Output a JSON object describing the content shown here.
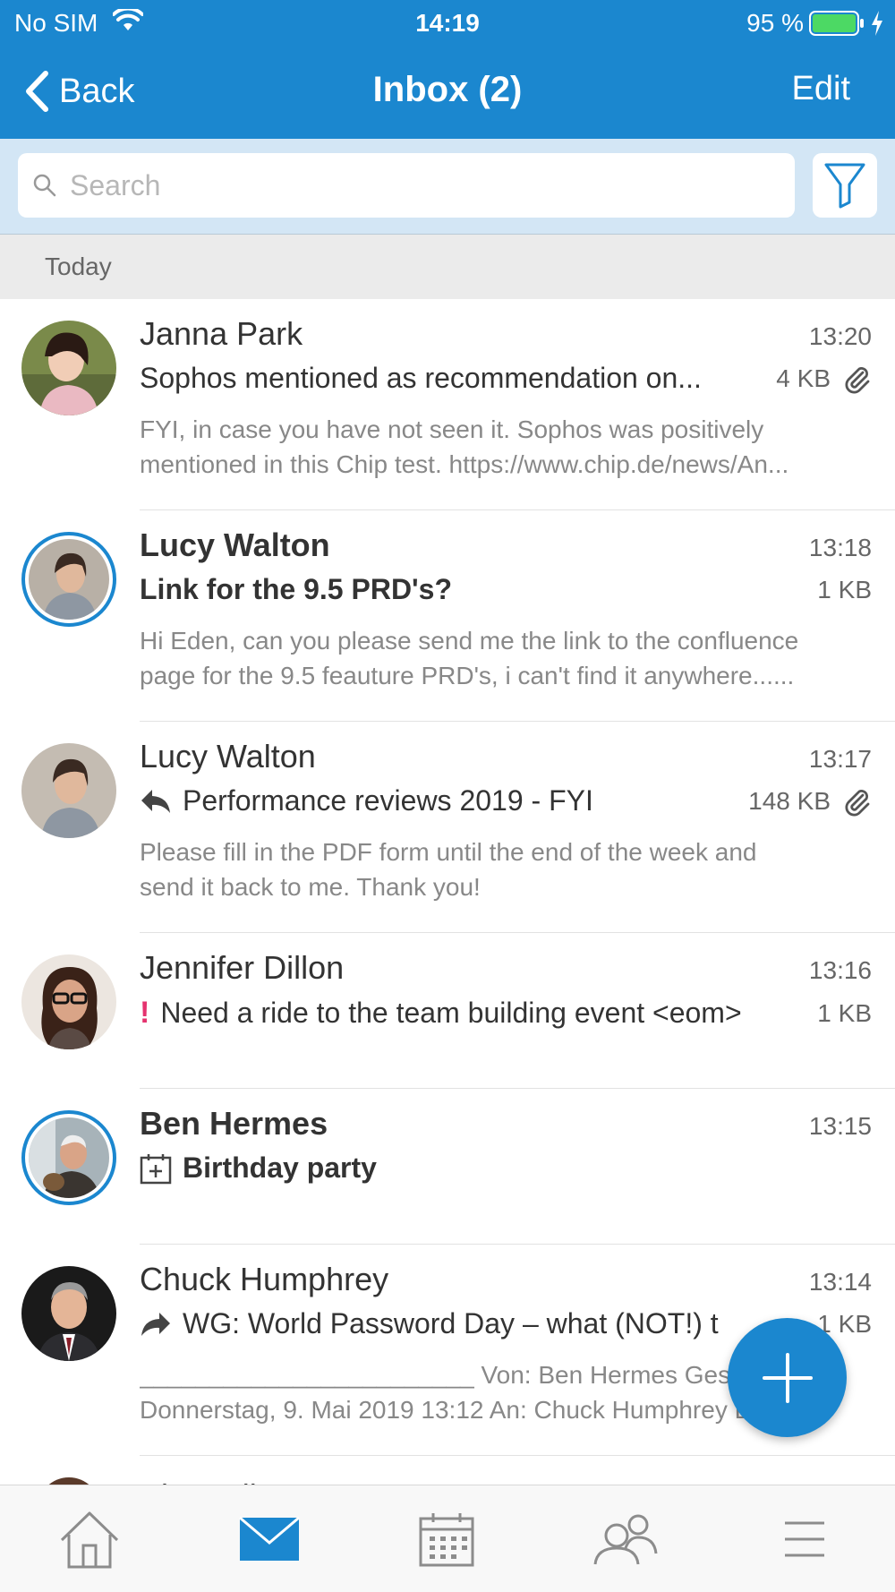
{
  "status_bar": {
    "carrier": "No SIM",
    "time": "14:19",
    "battery": "95 %"
  },
  "nav": {
    "back_label": "Back",
    "title": "Inbox (2)",
    "edit_label": "Edit"
  },
  "search": {
    "placeholder": "Search"
  },
  "section": {
    "label": "Today"
  },
  "colors": {
    "accent": "#1b87cf",
    "flag": "#e5336f"
  },
  "mails": [
    {
      "sender": "Janna Park",
      "time": "13:20",
      "subject": "Sophos mentioned as recommendation on...",
      "size": "4 KB",
      "attachment": true,
      "unread": false,
      "prefix_icon": "",
      "preview_line1": "FYI, in case you have not seen it. Sophos was positively",
      "preview_line2": "mentioned in this Chip test. https://www.chip.de/news/An..."
    },
    {
      "sender": "Lucy Walton",
      "time": "13:18",
      "subject": "Link for the 9.5 PRD's?",
      "size": "1 KB",
      "attachment": false,
      "unread": true,
      "prefix_icon": "",
      "preview_line1": "Hi Eden, can you please send me the link to the confluence",
      "preview_line2": "page for the 9.5 feauture PRD's, i can't find it anywhere......"
    },
    {
      "sender": "Lucy Walton",
      "time": "13:17",
      "subject": "Performance reviews 2019 - FYI",
      "size": "148 KB",
      "attachment": true,
      "unread": false,
      "prefix_icon": "reply-icon",
      "preview_line1": "Please fill in the PDF form until the end of the week and",
      "preview_line2": "send it back to me. Thank you!"
    },
    {
      "sender": "Jennifer Dillon",
      "time": "13:16",
      "subject": "Need a ride to the team building event <eom>",
      "size": "1 KB",
      "attachment": false,
      "unread": false,
      "prefix_icon": "priority-flag-icon",
      "prefix_text": "!"
    },
    {
      "sender": "Ben Hermes",
      "time": "13:15",
      "subject": "Birthday party",
      "unread": true,
      "prefix_icon": "calendar-invite-icon"
    },
    {
      "sender": "Chuck Humphrey",
      "time": "13:14",
      "subject": "WG: World Password Day – what (NOT!) t",
      "size": "1 KB",
      "attachment": false,
      "unread": false,
      "prefix_icon": "forward-icon",
      "preview_line1": "________________________ Von: Ben Hermes Gesendet:",
      "preview_line2": "Donnerstag, 9. Mai 2019 13:12 An: Chuck Humphrey Betreff..."
    }
  ],
  "partial_next_sender": "Pia Walker",
  "tabs": [
    {
      "icon": "home-icon"
    },
    {
      "icon": "mail-icon",
      "active": true
    },
    {
      "icon": "calendar-icon"
    },
    {
      "icon": "contacts-icon"
    },
    {
      "icon": "menu-icon"
    }
  ]
}
